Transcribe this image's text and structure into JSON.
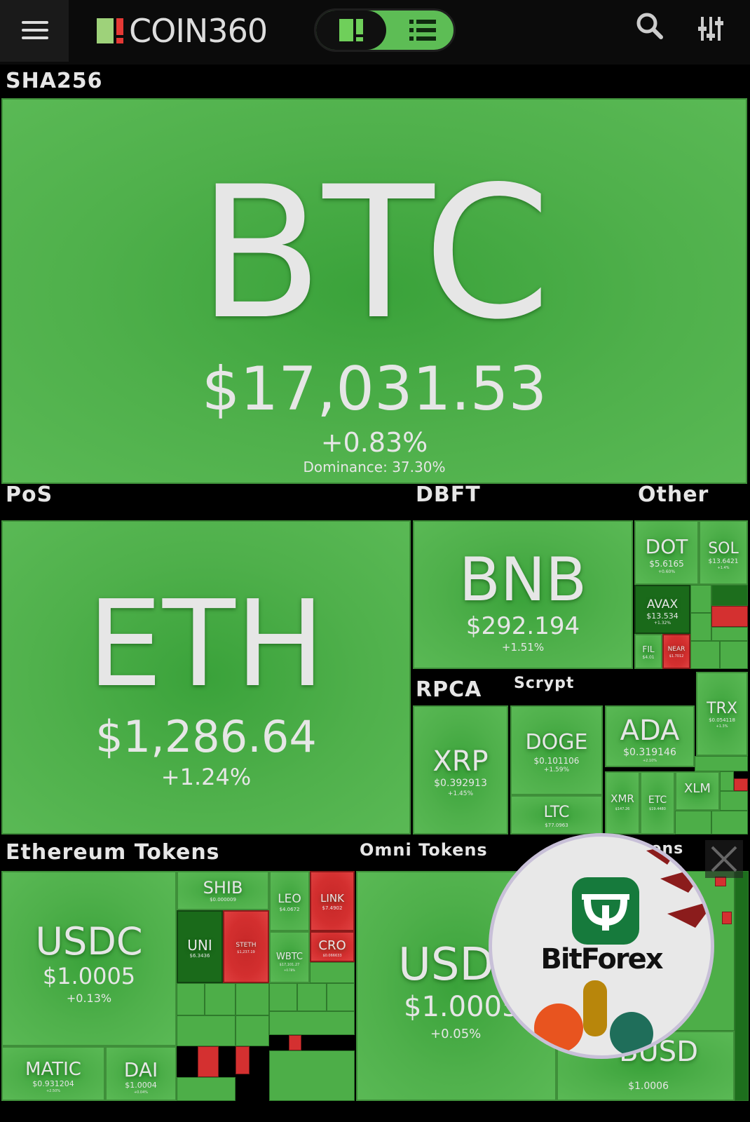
{
  "header": {
    "logo_text": "COIN360",
    "icons": [
      "menu-icon",
      "coin360-logo-icon",
      "treemap-view-icon",
      "list-view-icon",
      "search-icon",
      "filter-sliders-icon"
    ],
    "colors": {
      "accent": "#5dbd55",
      "logo_red": "#e53935",
      "bar_bg": "#0b0b0b"
    }
  },
  "sections": {
    "sha256": "SHA256",
    "pos": "PoS",
    "dbft": "DBFT",
    "other": "Other",
    "rpca": "RPCA",
    "scrypt": "Scrypt",
    "eth_tokens": "Ethereum Tokens",
    "omni_tokens": "Omni Tokens",
    "other_tokens": "Other Tokens"
  },
  "coins": {
    "btc": {
      "symbol": "BTC",
      "price": "$17,031.53",
      "change": "+0.83%",
      "dominance": "Dominance: 37.30%"
    },
    "eth": {
      "symbol": "ETH",
      "price": "$1,286.64",
      "change": "+1.24%"
    },
    "bnb": {
      "symbol": "BNB",
      "price": "$292.194",
      "change": "+1.51%"
    },
    "dot": {
      "symbol": "DOT",
      "price": "$5.6165",
      "change": "+0.60%"
    },
    "sol": {
      "symbol": "SOL",
      "price": "$13.6421",
      "change": "+1.4%"
    },
    "avax": {
      "symbol": "AVAX",
      "price": "$13.534",
      "change": "+1.32%"
    },
    "fil": {
      "symbol": "FIL",
      "price": "$4.01"
    },
    "near": {
      "symbol": "NEAR",
      "price": "$1.7012"
    },
    "trx": {
      "symbol": "TRX",
      "price": "$0.054118",
      "change": "+1.3%"
    },
    "xrp": {
      "symbol": "XRP",
      "price": "$0.392913",
      "change": "+1.45%"
    },
    "doge": {
      "symbol": "DOGE",
      "price": "$0.101106",
      "change": "+1.59%"
    },
    "ltc": {
      "symbol": "LTC",
      "price": "$77.0963"
    },
    "ada": {
      "symbol": "ADA",
      "price": "$0.319146",
      "change": "+2.10%"
    },
    "xmr": {
      "symbol": "XMR",
      "price": "$147.26"
    },
    "etc": {
      "symbol": "ETC",
      "price": "$19.4480"
    },
    "xlm": {
      "symbol": "XLM"
    },
    "usdc": {
      "symbol": "USDC",
      "price": "$1.0005",
      "change": "+0.13%"
    },
    "shib": {
      "symbol": "SHIB",
      "price": "$0.000009"
    },
    "leo": {
      "symbol": "LEO",
      "price": "$4.0672"
    },
    "link": {
      "symbol": "LINK",
      "price": "$7.4902"
    },
    "uni": {
      "symbol": "UNI",
      "price": "$6.3436"
    },
    "steth": {
      "symbol": "STETH",
      "price": "$1,237.19"
    },
    "wbtc": {
      "symbol": "WBTC",
      "price": "$17,101.27",
      "change": "+0.78%"
    },
    "cro": {
      "symbol": "CRO",
      "price": "$0.066633"
    },
    "matic": {
      "symbol": "MATIC",
      "price": "$0.931204",
      "change": "+2.50%"
    },
    "dai": {
      "symbol": "DAI",
      "price": "$1.0004",
      "change": "+0.04%"
    },
    "usdt": {
      "symbol": "USDT",
      "price": "$1.0005",
      "change": "+0.05%"
    },
    "busd": {
      "symbol": "BUSD",
      "price": "$1.0006"
    }
  },
  "ad": {
    "brand": "BitForex",
    "colors": {
      "brand_green": "#167a3c"
    }
  },
  "tile_colors": {
    "up": "#4fb04b",
    "down": "#d32f2f",
    "border": "#3f8f3a"
  }
}
